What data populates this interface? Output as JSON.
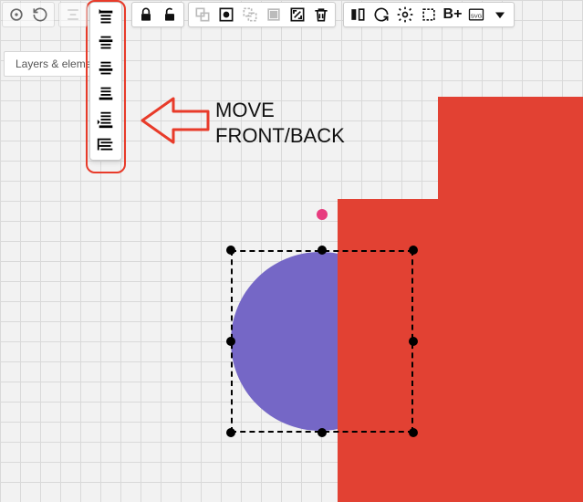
{
  "layers_panel": {
    "tab_label": "Layers & eleme",
    "add_label": "+"
  },
  "annotation": {
    "text_line1": "MOVE",
    "text_line2": "FRONT/BACK"
  },
  "toolbar": {
    "history": {
      "undo_redo": "undo-redo-dropdown",
      "refresh": "refresh"
    },
    "vertical_align": {
      "placeholder": "vertical-align"
    },
    "lock": {
      "lock": "lock",
      "unlock": "unlock"
    },
    "group_ops": {
      "group": "group",
      "select_children": "pick-child",
      "ungroup": "ungroup",
      "resize": "resize",
      "delete": "delete"
    },
    "object_ops": {
      "flip": "flip",
      "rotate": "rotate",
      "settings": "settings",
      "crop": "crop",
      "bold_plus": "B+",
      "export_svg": "export-svg",
      "more": "more"
    }
  },
  "zorder_dropdown": {
    "options": [
      "bring-to-front",
      "bring-forward",
      "middle",
      "send-backward",
      "send-to-back",
      "send-behind-all"
    ]
  },
  "canvas": {
    "shapes": [
      {
        "type": "rect",
        "name": "red-rect-large",
        "color": "#e24133"
      },
      {
        "type": "rect",
        "name": "red-rect-top",
        "color": "#e24133"
      },
      {
        "type": "circle",
        "name": "purple-circle",
        "color": "#7567c6",
        "selected": true
      }
    ],
    "rotation_handle_color": "#e73c7e"
  }
}
